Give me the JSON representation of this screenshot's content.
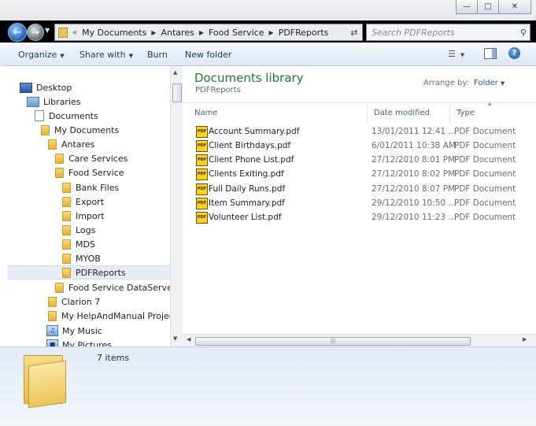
{
  "address": {
    "crumbs": [
      "My Documents",
      "Antares",
      "Food Service",
      "PDFReports"
    ]
  },
  "search": {
    "placeholder": "Search PDFReports"
  },
  "toolbar": {
    "organize": "Organize",
    "share_with": "Share with",
    "burn": "Burn",
    "new_folder": "New folder"
  },
  "nav": {
    "items": [
      {
        "label": "Desktop",
        "icon": "desktop-icon"
      },
      {
        "label": "Libraries",
        "icon": "libraries-icon"
      },
      {
        "label": "Documents",
        "icon": "documents-icon"
      },
      {
        "label": "My Documents",
        "icon": "folder-icon"
      },
      {
        "label": "Antares",
        "icon": "folder-icon"
      },
      {
        "label": "Care Services",
        "icon": "folder-icon"
      },
      {
        "label": "Food Service",
        "icon": "folder-icon"
      },
      {
        "label": "Bank Files",
        "icon": "folder-icon"
      },
      {
        "label": "Export",
        "icon": "folder-icon"
      },
      {
        "label": "Import",
        "icon": "folder-icon"
      },
      {
        "label": "Logs",
        "icon": "folder-icon"
      },
      {
        "label": "MDS",
        "icon": "folder-icon"
      },
      {
        "label": "MYOB",
        "icon": "folder-icon"
      },
      {
        "label": "PDFReports",
        "icon": "folder-icon"
      },
      {
        "label": "Food Service DataServer",
        "icon": "folder-icon"
      },
      {
        "label": "Clarion 7",
        "icon": "folder-icon"
      },
      {
        "label": "My HelpAndManual Projects",
        "icon": "folder-icon"
      },
      {
        "label": "My Music",
        "icon": "music-icon"
      },
      {
        "label": "My Pictures",
        "icon": "pictures-icon"
      }
    ],
    "selected": "PDFReports"
  },
  "library": {
    "title": "Documents library",
    "subtitle": "PDFReports",
    "arrange_label": "Arrange by:",
    "arrange_value": "Folder"
  },
  "columns": {
    "name": "Name",
    "date": "Date modified",
    "type": "Type"
  },
  "files": [
    {
      "name": "Account Summary.pdf",
      "date": "13/01/2011 12:41 ...",
      "type": "PDF Document"
    },
    {
      "name": "Client Birthdays.pdf",
      "date": "6/01/2011 10:38 AM",
      "type": "PDF Document"
    },
    {
      "name": "Client Phone List.pdf",
      "date": "27/12/2010 8:01 PM",
      "type": "PDF Document"
    },
    {
      "name": "Clients Exiting.pdf",
      "date": "27/12/2010 8:02 PM",
      "type": "PDF Document"
    },
    {
      "name": "Full Daily Runs.pdf",
      "date": "27/12/2010 8:07 PM",
      "type": "PDF Document"
    },
    {
      "name": "Item Summary.pdf",
      "date": "29/12/2010 10:50 ...",
      "type": "PDF Document"
    },
    {
      "name": "Volunteer List.pdf",
      "date": "29/12/2010 11:23 ...",
      "type": "PDF Document"
    }
  ],
  "details": {
    "count": "7 items"
  }
}
